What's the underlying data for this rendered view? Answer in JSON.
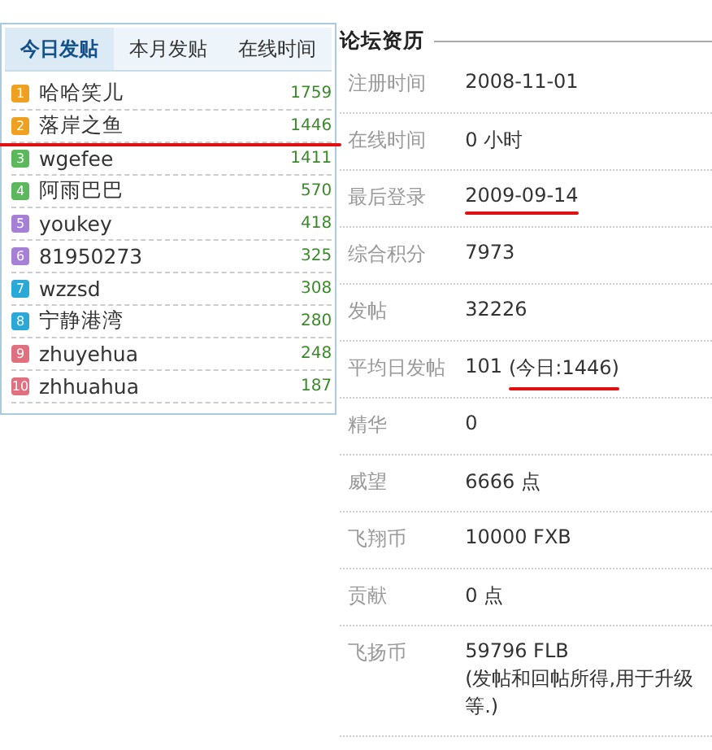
{
  "ranking": {
    "tabs": [
      {
        "label": "今日发贴",
        "selected": true
      },
      {
        "label": "本月发贴",
        "selected": false
      },
      {
        "label": "在线时间",
        "selected": false
      }
    ],
    "items": [
      {
        "rank": "1",
        "name": "哈哈笑儿",
        "count": "1759",
        "color": "#f0a020",
        "marked": false
      },
      {
        "rank": "2",
        "name": "落岸之鱼",
        "count": "1446",
        "color": "#f0a020",
        "marked": true
      },
      {
        "rank": "3",
        "name": "wgefee",
        "count": "1411",
        "color": "#5cb85c",
        "marked": false
      },
      {
        "rank": "4",
        "name": "阿雨巴巴",
        "count": "570",
        "color": "#5cb85c",
        "marked": false
      },
      {
        "rank": "5",
        "name": "youkey",
        "count": "418",
        "color": "#a67fd6",
        "marked": false
      },
      {
        "rank": "6",
        "name": "81950273",
        "count": "325",
        "color": "#a67fd6",
        "marked": false
      },
      {
        "rank": "7",
        "name": "wzzsd",
        "count": "308",
        "color": "#2aa8d8",
        "marked": false
      },
      {
        "rank": "8",
        "name": "宁静港湾",
        "count": "280",
        "color": "#2aa8d8",
        "marked": false
      },
      {
        "rank": "9",
        "name": "zhuyehua",
        "count": "248",
        "color": "#e07080",
        "marked": false
      },
      {
        "rank": "10",
        "name": "zhhuahua",
        "count": "187",
        "color": "#e07080",
        "marked": false
      }
    ]
  },
  "profile": {
    "title": "论坛资历",
    "rows": [
      {
        "label": "注册时间",
        "value": "2008-11-01",
        "marked": false
      },
      {
        "label": "在线时间",
        "value": "0 小时",
        "marked": false
      },
      {
        "label": "最后登录",
        "value": "2009-09-14",
        "marked": true
      },
      {
        "label": "综合积分",
        "value": "7973",
        "marked": false
      },
      {
        "label": "发帖",
        "value": "32226",
        "marked": false
      },
      {
        "label": "平均日发帖",
        "value": "101",
        "extra": "(今日:1446)",
        "marked": true
      },
      {
        "label": "精华",
        "value": "0",
        "marked": false
      },
      {
        "label": "威望",
        "value": "6666 点",
        "marked": false
      },
      {
        "label": "飞翔币",
        "value": "10000 FXB",
        "marked": false
      },
      {
        "label": "贡献",
        "value": "0 点",
        "marked": false
      },
      {
        "label": "飞扬币",
        "value": "59796 FLB",
        "note": "(发帖和回帖所得,用于升级等.)",
        "marked": false
      }
    ]
  }
}
